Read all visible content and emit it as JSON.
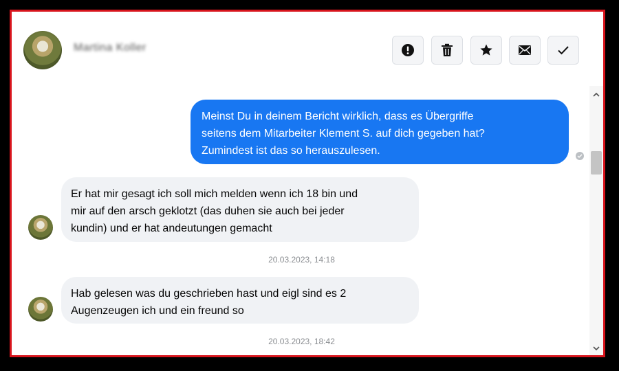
{
  "contact": {
    "name": "Martina Koller"
  },
  "header_actions": [
    {
      "label": "Report",
      "icon": "exclamation-icon"
    },
    {
      "label": "Delete",
      "icon": "trash-icon"
    },
    {
      "label": "Star",
      "icon": "star-icon"
    },
    {
      "label": "Mail",
      "icon": "envelope-icon"
    },
    {
      "label": "Done",
      "icon": "check-icon"
    }
  ],
  "messages": [
    {
      "direction": "outgoing",
      "lines": [
        "Meinst Du in deinem Bericht wirklich, dass es Übergriffe",
        "seitens dem Mitarbeiter Klement S. auf dich gegeben hat?",
        "Zumindest ist das so herauszulesen."
      ]
    },
    {
      "direction": "incoming",
      "lines": [
        "Er hat mir gesagt ich soll mich melden wenn ich 18 bin und",
        "mir auf den arsch geklotzt (das duhen sie auch bei jeder",
        "kundin) und er hat andeutungen gemacht"
      ]
    },
    {
      "direction": "incoming",
      "lines": [
        "Hab gelesen was du geschrieben hast und eigl sind es 2",
        "Augenzeugen ich und ein freund so"
      ]
    }
  ],
  "timestamps": [
    "20.03.2023, 14:18",
    "20.03.2023, 18:42"
  ],
  "colors": {
    "outgoing_bubble": "#1877f2",
    "incoming_bubble": "#f0f2f5",
    "frame_border": "#d8141c"
  }
}
